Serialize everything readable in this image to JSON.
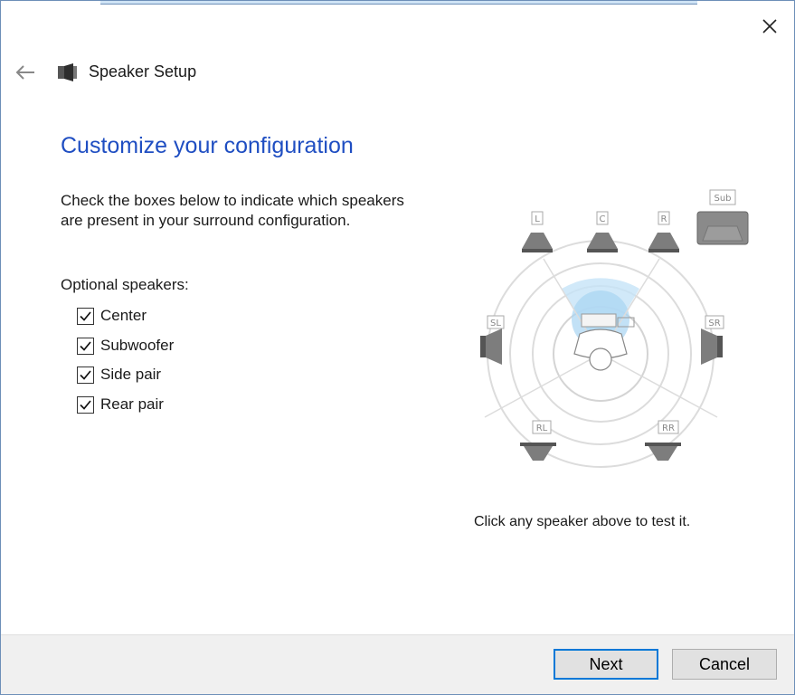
{
  "window": {
    "title": "Speaker Setup",
    "close_icon": "close-icon",
    "back_icon": "back-arrow-icon",
    "app_icon": "speaker-icon"
  },
  "page": {
    "heading": "Customize your configuration",
    "instructions": "Check the boxes below to indicate which speakers are present in your surround configuration.",
    "optional_label": "Optional speakers:"
  },
  "checkboxes": [
    {
      "label": "Center",
      "checked": true
    },
    {
      "label": "Subwoofer",
      "checked": true
    },
    {
      "label": "Side pair",
      "checked": true
    },
    {
      "label": "Rear pair",
      "checked": true
    }
  ],
  "diagram": {
    "speakers": {
      "L": "L",
      "C": "C",
      "R": "R",
      "SUB": "Sub",
      "SL": "SL",
      "SR": "SR",
      "RL": "RL",
      "RR": "RR"
    },
    "test_hint": "Click any speaker above to test it."
  },
  "buttons": {
    "next": "Next",
    "cancel": "Cancel"
  },
  "colors": {
    "heading": "#1f4ec2",
    "accent": "#0078d7",
    "footer_bg": "#f0f0f0"
  }
}
